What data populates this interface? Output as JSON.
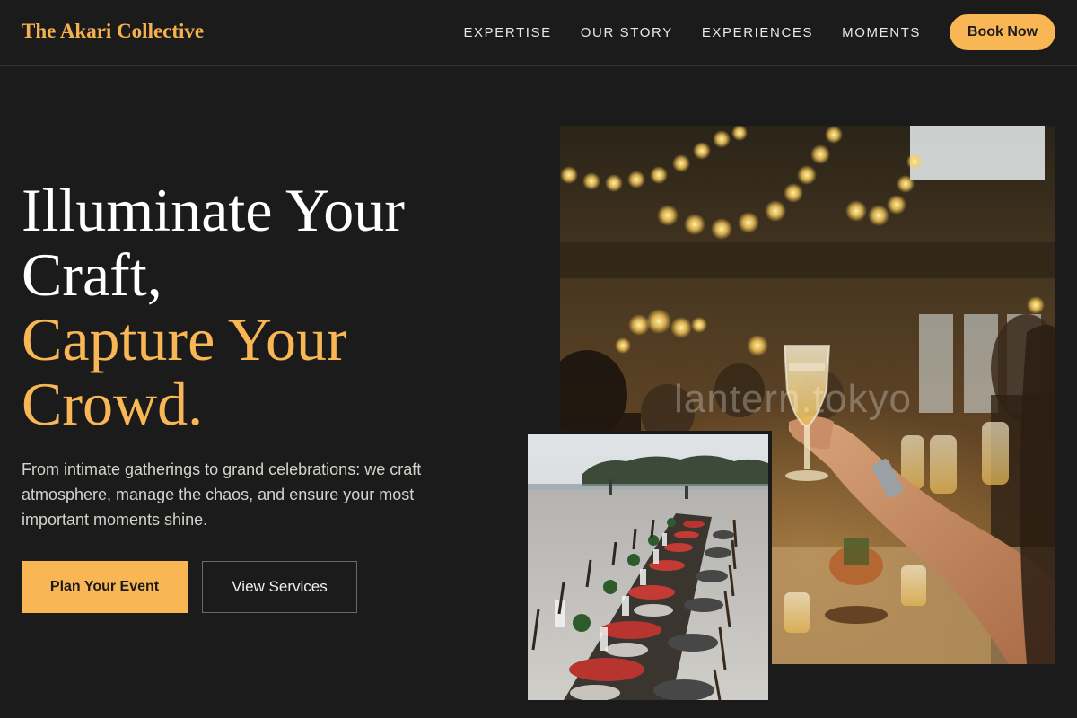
{
  "header": {
    "brand": "The Akari Collective",
    "nav": [
      "EXPERTISE",
      "OUR STORY",
      "EXPERIENCES",
      "MOMENTS"
    ],
    "cta": "Book Now"
  },
  "hero": {
    "headline_line1": "Illuminate Your",
    "headline_line2": "Craft,",
    "headline_line3": "Capture Your",
    "headline_line4": "Crowd.",
    "subtext": "From intimate gatherings to grand celebrations: we craft atmosphere, manage the chaos, and ensure your most important moments shine.",
    "primary_button": "Plan Your Event",
    "secondary_button": "View Services"
  },
  "images": {
    "main_photo": "celebration-toast-photo",
    "watermark": "lantern.tokyo",
    "secondary_photo": "beach-dinner-table-photo"
  },
  "colors": {
    "background": "#1c1b1b",
    "accent": "#f8b654",
    "text": "#f2efe9"
  }
}
